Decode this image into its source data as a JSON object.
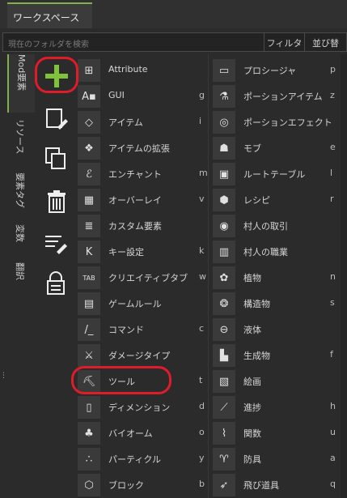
{
  "header": {
    "tab_label": "ワークスペース"
  },
  "search": {
    "placeholder": "現在のフォルダを検索",
    "filter_label": "フィルタ",
    "sort_label": "並び替"
  },
  "vtabs": [
    "Mod要素",
    "リソース",
    "要素タグ",
    "変数",
    "翻訳"
  ],
  "tools": [
    "plus-icon",
    "new-file-icon",
    "duplicate-icon",
    "trash-icon",
    "edit-list-icon",
    "lock-icon"
  ],
  "left_items": [
    {
      "label": "Attribute",
      "key": "",
      "icon": "attribute-icon"
    },
    {
      "label": "GUI",
      "key": "g",
      "icon": "gui-icon"
    },
    {
      "label": "アイテム",
      "key": "i",
      "icon": "diamond-icon"
    },
    {
      "label": "アイテムの拡張",
      "key": "",
      "icon": "item-extension-icon"
    },
    {
      "label": "エンチャント",
      "key": "m",
      "icon": "enchant-icon"
    },
    {
      "label": "オーバーレイ",
      "key": "v",
      "icon": "overlay-icon"
    },
    {
      "label": "カスタム要素",
      "key": "",
      "icon": "custom-element-icon"
    },
    {
      "label": "キー設定",
      "key": "k",
      "icon": "key-icon"
    },
    {
      "label": "クリエイティブタブ",
      "key": "w",
      "icon": "tab-icon"
    },
    {
      "label": "ゲームルール",
      "key": "",
      "icon": "gamerule-icon"
    },
    {
      "label": "コマンド",
      "key": "c",
      "icon": "command-icon"
    },
    {
      "label": "ダメージタイプ",
      "key": "",
      "icon": "damage-icon"
    },
    {
      "label": "ツール",
      "key": "t",
      "icon": "pickaxe-icon"
    },
    {
      "label": "ディメンション",
      "key": "d",
      "icon": "dimension-icon"
    },
    {
      "label": "バイオーム",
      "key": "o",
      "icon": "tree-icon"
    },
    {
      "label": "パーティクル",
      "key": "y",
      "icon": "particle-icon"
    },
    {
      "label": "ブロック",
      "key": "b",
      "icon": "cube-icon"
    }
  ],
  "right_items": [
    {
      "label": "プロシージャ",
      "key": "p",
      "icon": "folder-icon"
    },
    {
      "label": "ポーションアイテム",
      "key": "z",
      "icon": "flask-icon"
    },
    {
      "label": "ポーションエフェクト",
      "key": "",
      "icon": "effect-icon"
    },
    {
      "label": "モブ",
      "key": "e",
      "icon": "mob-icon"
    },
    {
      "label": "ルートテーブル",
      "key": "l",
      "icon": "loot-icon"
    },
    {
      "label": "レシピ",
      "key": "r",
      "icon": "recipe-icon"
    },
    {
      "label": "村人の取引",
      "key": "",
      "icon": "trade-icon"
    },
    {
      "label": "村人の職業",
      "key": "",
      "icon": "profession-icon"
    },
    {
      "label": "植物",
      "key": "n",
      "icon": "plant-icon"
    },
    {
      "label": "構造物",
      "key": "s",
      "icon": "structure-icon"
    },
    {
      "label": "液体",
      "key": "",
      "icon": "fluid-icon"
    },
    {
      "label": "生成物",
      "key": "f",
      "icon": "generation-icon"
    },
    {
      "label": "絵画",
      "key": "",
      "icon": "painting-icon"
    },
    {
      "label": "進捗",
      "key": "h",
      "icon": "progress-icon"
    },
    {
      "label": "関数",
      "key": "u",
      "icon": "function-icon"
    },
    {
      "label": "防具",
      "key": "a",
      "icon": "armor-icon"
    },
    {
      "label": "飛び道具",
      "key": "q",
      "icon": "projectile-icon"
    }
  ]
}
